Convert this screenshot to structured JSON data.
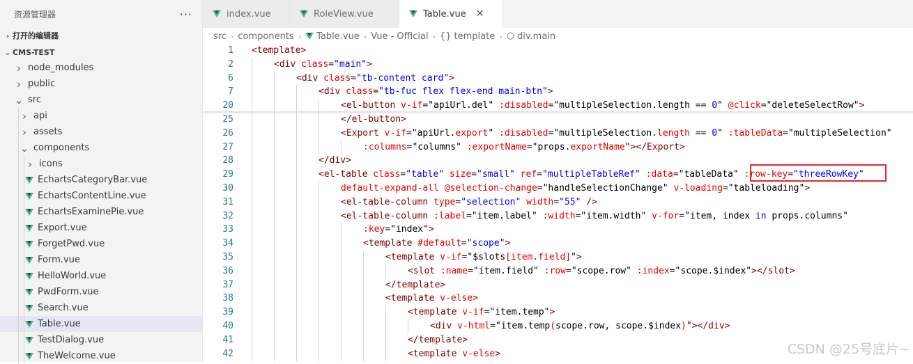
{
  "sidebar": {
    "title": "资源管理器",
    "more": "···",
    "open_editors": "打开的编辑器",
    "project": "CMS-TEST",
    "items": [
      {
        "label": "node_modules",
        "type": "folder",
        "open": false,
        "indent": 1
      },
      {
        "label": "public",
        "type": "folder",
        "open": false,
        "indent": 1
      },
      {
        "label": "src",
        "type": "folder",
        "open": true,
        "indent": 1
      },
      {
        "label": "api",
        "type": "folder",
        "open": false,
        "indent": 2
      },
      {
        "label": "assets",
        "type": "folder",
        "open": false,
        "indent": 2
      },
      {
        "label": "components",
        "type": "folder",
        "open": true,
        "indent": 2
      },
      {
        "label": "icons",
        "type": "folder",
        "open": false,
        "indent": 3
      },
      {
        "label": "EchartsCategoryBar.vue",
        "type": "vue",
        "indent": 3
      },
      {
        "label": "EchartsContentLine.vue",
        "type": "vue",
        "indent": 3
      },
      {
        "label": "EchartsExaminePie.vue",
        "type": "vue",
        "indent": 3
      },
      {
        "label": "Export.vue",
        "type": "vue",
        "indent": 3
      },
      {
        "label": "ForgetPwd.vue",
        "type": "vue",
        "indent": 3
      },
      {
        "label": "Form.vue",
        "type": "vue",
        "indent": 3
      },
      {
        "label": "HelloWorld.vue",
        "type": "vue",
        "indent": 3
      },
      {
        "label": "PwdForm.vue",
        "type": "vue",
        "indent": 3
      },
      {
        "label": "Search.vue",
        "type": "vue",
        "indent": 3
      },
      {
        "label": "Table.vue",
        "type": "vue",
        "indent": 3,
        "selected": true
      },
      {
        "label": "TestDialog.vue",
        "type": "vue",
        "indent": 3
      },
      {
        "label": "TheWelcome.vue",
        "type": "vue",
        "indent": 3
      }
    ]
  },
  "tabs": [
    {
      "label": "index.vue",
      "active": false
    },
    {
      "label": "RoleView.vue",
      "active": false
    },
    {
      "label": "Table.vue",
      "active": true,
      "close": "✕"
    }
  ],
  "breadcrumb": [
    "src",
    "components",
    "Table.vue",
    "Vue - Official",
    "template",
    "div.main"
  ],
  "editor": {
    "lines": [
      {
        "n": "1",
        "indent": 0,
        "tokens": [
          [
            "t",
            "<template>"
          ]
        ]
      },
      {
        "n": "2",
        "indent": 1,
        "tokens": [
          [
            "t",
            "<div "
          ],
          [
            "a",
            "class"
          ],
          [
            "p",
            "="
          ],
          [
            "s",
            "\"main\""
          ],
          [
            "t",
            ">"
          ]
        ]
      },
      {
        "n": "6",
        "indent": 2,
        "tokens": [
          [
            "t",
            "<div "
          ],
          [
            "a",
            "class"
          ],
          [
            "p",
            "="
          ],
          [
            "s",
            "\"tb-content card\""
          ],
          [
            "t",
            ">"
          ]
        ]
      },
      {
        "n": "7",
        "indent": 3,
        "tokens": [
          [
            "t",
            "<div "
          ],
          [
            "a",
            "class"
          ],
          [
            "p",
            "="
          ],
          [
            "s",
            "\"tb-fuc flex flex-end main-btn\""
          ],
          [
            "t",
            ">"
          ]
        ]
      },
      {
        "n": "20",
        "indent": 4,
        "tokens": [
          [
            "t",
            "<el-button "
          ],
          [
            "a",
            "v-if"
          ],
          [
            "p",
            "=\"apiUrl."
          ],
          [
            "p",
            "del\" "
          ],
          [
            "a",
            ":disabled"
          ],
          [
            "p",
            "=\"multipleSelection.length == "
          ],
          [
            "s",
            "0"
          ],
          [
            "p",
            "\" "
          ],
          [
            "a",
            "@click"
          ],
          [
            "p",
            "=\"deleteSelectRow\""
          ],
          [
            "t",
            ">"
          ]
        ]
      },
      {
        "n": "25",
        "indent": 4,
        "tokens": [
          [
            "t",
            "</el-button>"
          ]
        ]
      },
      {
        "n": "26",
        "indent": 4,
        "tokens": [
          [
            "t",
            "<Export "
          ],
          [
            "a",
            "v-if"
          ],
          [
            "p",
            "=\"apiUrl."
          ],
          [
            "a",
            "export"
          ],
          [
            "p",
            "\" "
          ],
          [
            "a",
            ":disabled"
          ],
          [
            "p",
            "=\"multipleSelection."
          ],
          [
            "a",
            "length"
          ],
          [
            "p",
            " == "
          ],
          [
            "s",
            "0"
          ],
          [
            "p",
            "\" "
          ],
          [
            "a",
            ":tableData"
          ],
          [
            "p",
            "=\"multipleSelection\""
          ]
        ]
      },
      {
        "n": "27",
        "indent": 5,
        "tokens": [
          [
            "a",
            ":columns"
          ],
          [
            "p",
            "=\"columns\" "
          ],
          [
            "a",
            ":exportName"
          ],
          [
            "p",
            "=\"props."
          ],
          [
            "a",
            "exportName"
          ],
          [
            "p",
            "\""
          ],
          [
            "t",
            "></Export>"
          ]
        ]
      },
      {
        "n": "28",
        "indent": 3,
        "tokens": [
          [
            "t",
            "</div>"
          ]
        ]
      },
      {
        "n": "29",
        "indent": 3,
        "tokens": [
          [
            "t",
            "<el-table "
          ],
          [
            "a",
            "class"
          ],
          [
            "p",
            "="
          ],
          [
            "s",
            "\"table\""
          ],
          [
            "p",
            " "
          ],
          [
            "a",
            "size"
          ],
          [
            "p",
            "="
          ],
          [
            "s",
            "\"small\""
          ],
          [
            "p",
            " "
          ],
          [
            "a",
            "ref"
          ],
          [
            "p",
            "="
          ],
          [
            "s",
            "\"multipleTableRef\""
          ],
          [
            "p",
            " "
          ],
          [
            "a",
            ":data"
          ],
          [
            "p",
            "=\"tableData\" "
          ],
          [
            "a",
            ":row-key"
          ],
          [
            "p",
            "="
          ],
          [
            "s",
            "\"threeRowKey\""
          ]
        ]
      },
      {
        "n": "30",
        "indent": 4,
        "tokens": [
          [
            "a",
            "default-expand-all "
          ],
          [
            "a",
            "@selection-change"
          ],
          [
            "p",
            "=\"handleSelectionChange\" "
          ],
          [
            "a",
            "v-loading"
          ],
          [
            "p",
            "=\"tableloading\""
          ],
          [
            "t",
            ">"
          ]
        ]
      },
      {
        "n": "31",
        "indent": 4,
        "tokens": [
          [
            "t",
            "<el-table-column "
          ],
          [
            "a",
            "type"
          ],
          [
            "p",
            "="
          ],
          [
            "s",
            "\"selection\""
          ],
          [
            "p",
            " "
          ],
          [
            "a",
            "width"
          ],
          [
            "p",
            "="
          ],
          [
            "s",
            "\"55\""
          ],
          [
            "p",
            " "
          ],
          [
            "t",
            "/>"
          ]
        ]
      },
      {
        "n": "32",
        "indent": 4,
        "tokens": [
          [
            "t",
            "<el-table-column "
          ],
          [
            "a",
            ":label"
          ],
          [
            "p",
            "=\"item.label\" "
          ],
          [
            "a",
            ":width"
          ],
          [
            "p",
            "=\"item.width\" "
          ],
          [
            "a",
            "v-for"
          ],
          [
            "p",
            "=\"item, index "
          ],
          [
            "k",
            "in"
          ],
          [
            "p",
            " props.columns\""
          ]
        ]
      },
      {
        "n": "33",
        "indent": 5,
        "tokens": [
          [
            "a",
            ":key"
          ],
          [
            "p",
            "=\"index\""
          ],
          [
            "t",
            ">"
          ]
        ]
      },
      {
        "n": "34",
        "indent": 5,
        "tokens": [
          [
            "t",
            "<template "
          ],
          [
            "a",
            "#default"
          ],
          [
            "p",
            "="
          ],
          [
            "s",
            "\"scope\""
          ],
          [
            "t",
            ">"
          ]
        ]
      },
      {
        "n": "35",
        "indent": 6,
        "tokens": [
          [
            "t",
            "<template "
          ],
          [
            "a",
            "v-if"
          ],
          [
            "p",
            "=\"$slots"
          ],
          [
            "a",
            "[item.field]"
          ],
          [
            "p",
            "\""
          ],
          [
            "t",
            ">"
          ]
        ]
      },
      {
        "n": "36",
        "indent": 7,
        "tokens": [
          [
            "t",
            "<slot "
          ],
          [
            "a",
            ":name"
          ],
          [
            "p",
            "=\"item.field\" "
          ],
          [
            "a",
            ":row"
          ],
          [
            "p",
            "=\"scope.row\" "
          ],
          [
            "a",
            ":index"
          ],
          [
            "p",
            "=\"scope.$index\""
          ],
          [
            "t",
            "></slot>"
          ]
        ]
      },
      {
        "n": "37",
        "indent": 6,
        "tokens": [
          [
            "t",
            "</template>"
          ]
        ]
      },
      {
        "n": "38",
        "indent": 6,
        "tokens": [
          [
            "t",
            "<template "
          ],
          [
            "a",
            "v-else"
          ],
          [
            "t",
            ">"
          ]
        ]
      },
      {
        "n": "39",
        "indent": 7,
        "tokens": [
          [
            "t",
            "<template "
          ],
          [
            "a",
            "v-if"
          ],
          [
            "p",
            "=\"item.temp\""
          ],
          [
            "t",
            ">"
          ]
        ]
      },
      {
        "n": "40",
        "indent": 8,
        "tokens": [
          [
            "t",
            "<div "
          ],
          [
            "a",
            "v-html"
          ],
          [
            "p",
            "=\"item.temp"
          ],
          [
            "a",
            "("
          ],
          [
            "p",
            "scope.row, scope.$index"
          ],
          [
            "a",
            ")"
          ],
          [
            "p",
            "\""
          ],
          [
            "t",
            "></div>"
          ]
        ]
      },
      {
        "n": "41",
        "indent": 7,
        "tokens": [
          [
            "t",
            "</template>"
          ]
        ]
      },
      {
        "n": "42",
        "indent": 7,
        "tokens": [
          [
            "t",
            "<template "
          ],
          [
            "a",
            "v-else"
          ],
          [
            "t",
            ">"
          ]
        ]
      }
    ]
  },
  "watermark": "CSDN @25号底片~"
}
